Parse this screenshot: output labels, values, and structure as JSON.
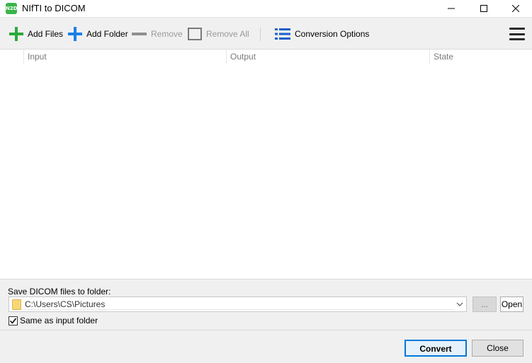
{
  "window": {
    "title": "NIfTI to DICOM",
    "app_icon_text": "N2D"
  },
  "toolbar": {
    "add_files": "Add Files",
    "add_folder": "Add Folder",
    "remove": "Remove",
    "remove_all": "Remove All",
    "conversion_options": "Conversion Options",
    "icons": {
      "add_files": "plus-icon",
      "add_folder": "plus-icon",
      "remove": "minus-icon",
      "remove_all": "square-icon",
      "conversion_options": "list-icon",
      "menu": "hamburger-icon"
    }
  },
  "list": {
    "columns": [
      "Input",
      "Output",
      "State"
    ]
  },
  "output": {
    "label": "Save DICOM files to folder:",
    "path": "C:\\Users\\CS\\Pictures",
    "browse_label": "...",
    "open_label": "Open",
    "same_as_input_label": "Same as input folder",
    "same_as_input_checked": true
  },
  "footer": {
    "convert_label": "Convert",
    "close_label": "Close"
  },
  "colors": {
    "add_files_icon": "#2aaa3a",
    "add_folder_icon": "#1a7fe8",
    "conversion_icon": "#1a5fc8",
    "accent": "#0078d7"
  }
}
